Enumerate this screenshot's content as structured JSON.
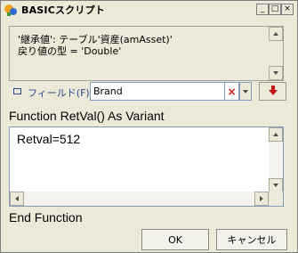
{
  "window": {
    "title": "BASICスクリプト",
    "icon": "script-app-icon",
    "controls": {
      "minimize": "_",
      "restore": "□",
      "close": "×"
    }
  },
  "info": {
    "line1": "'継承値': テーブル'資産(amAsset)'",
    "line2": "戻り値の型 = 'Double'"
  },
  "field_row": {
    "label": "フィールド(F):",
    "value": "Brand",
    "clear_symbol": "×",
    "icon": "table-field-icon",
    "insert_icon": "insert-down-arrow-icon"
  },
  "editor": {
    "header": "Function RetVal() As Variant",
    "code": "Retval=512",
    "footer": "End Function"
  },
  "buttons": {
    "ok": "OK",
    "cancel": "キャンセル"
  },
  "colors": {
    "accent_red": "#d41616",
    "label_blue": "#2b4a8c"
  }
}
